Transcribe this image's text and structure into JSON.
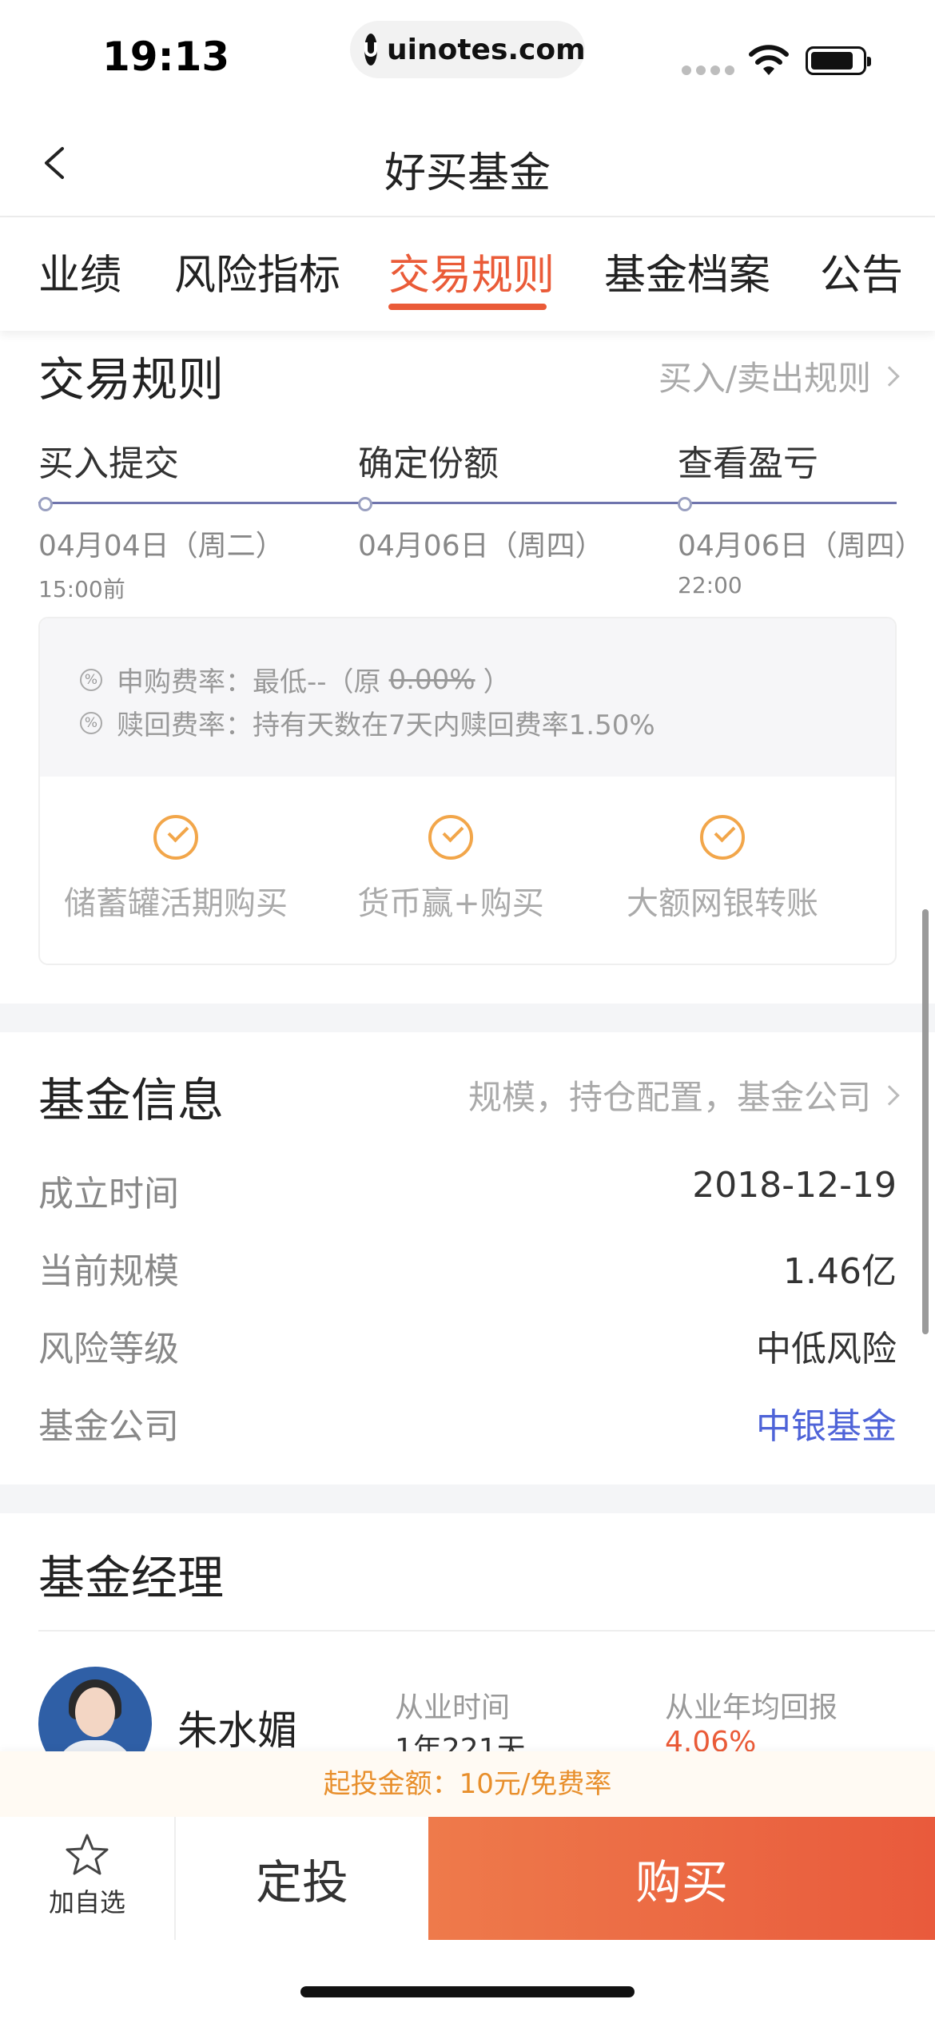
{
  "status": {
    "time": "19:13",
    "url": "uinotes.com"
  },
  "nav": {
    "title": "好买基金"
  },
  "tabs": [
    "业绩",
    "风险指标",
    "交易规则",
    "基金档案",
    "公告"
  ],
  "trade_rules": {
    "title": "交易规则",
    "link": "买入/卖出规则",
    "steps": [
      {
        "label": "买入提交",
        "date": "04月04日（周二）",
        "time": "15:00前"
      },
      {
        "label": "确定份额",
        "date": "04月06日（周四）",
        "time": ""
      },
      {
        "label": "查看盈亏",
        "date": "04月06日（周四）",
        "time": "22:00"
      }
    ],
    "fees": {
      "subscribe_prefix": "申购费率：最低--（原",
      "subscribe_original": "0.00%",
      "subscribe_suffix": "）",
      "redeem": "赎回费率：持有天数在7天内赎回费率1.50%"
    },
    "payment_options": [
      "储蓄罐活期购买",
      "货币赢+购买",
      "大额网银转账"
    ]
  },
  "fund_info": {
    "title": "基金信息",
    "link": "规模，持仓配置，基金公司",
    "rows": [
      {
        "label": "成立时间",
        "value": "2018-12-19"
      },
      {
        "label": "当前规模",
        "value": "1.46亿"
      },
      {
        "label": "风险等级",
        "value": "中低风险"
      },
      {
        "label": "基金公司",
        "value": "中银基金"
      }
    ]
  },
  "manager": {
    "title": "基金经理",
    "name": "朱水媚",
    "tenure_label": "从业时间",
    "tenure_value": "1年221天",
    "return_label": "从业年均回报",
    "return_value": "4.06%"
  },
  "bottom": {
    "promo": "起投金额：10元/免费率",
    "favorite": "加自选",
    "regular": "定投",
    "buy": "购买"
  },
  "colors": {
    "accent": "#ea5b38",
    "link": "#4e63d8",
    "check": "#f2a64a"
  }
}
